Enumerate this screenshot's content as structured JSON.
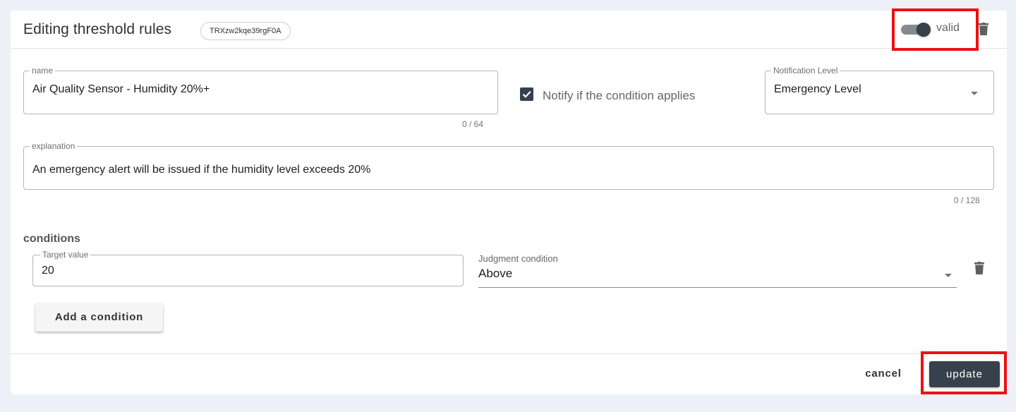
{
  "header": {
    "title": "Editing threshold rules",
    "rule_id": "TRXzw2kqe39rgF0A",
    "toggle_label": "valid",
    "toggle_on": true,
    "delete_icon": "trash-icon"
  },
  "form": {
    "name": {
      "label": "name",
      "value": "Air Quality Sensor - Humidity 20%+",
      "counter": "0 / 64"
    },
    "notify": {
      "label": "Notify if the condition applies",
      "checked": true
    },
    "notification_level": {
      "label": "Notification Level",
      "value": "Emergency Level"
    },
    "explanation": {
      "label": "explanation",
      "value": "An emergency alert will be issued if the humidity level exceeds 20%",
      "counter": "0 / 128"
    }
  },
  "conditions": {
    "heading": "conditions",
    "items": [
      {
        "target_label": "Target value",
        "target_value": "20",
        "judgment_label": "Judgment condition",
        "judgment_value": "Above"
      }
    ],
    "add_label": "Add a condition"
  },
  "footer": {
    "cancel_label": "cancel",
    "update_label": "update"
  },
  "colors": {
    "accent": "#37414b",
    "highlight": "#ee1010",
    "background": "#edf1f7"
  }
}
